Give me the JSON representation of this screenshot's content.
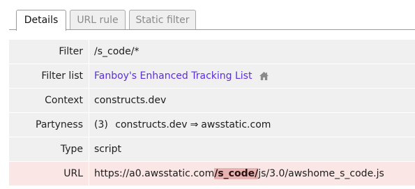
{
  "tabs": [
    {
      "label": "Details",
      "active": true
    },
    {
      "label": "URL rule",
      "active": false
    },
    {
      "label": "Static filter",
      "active": false
    }
  ],
  "details": {
    "filter": {
      "label": "Filter",
      "value": "/s_code/*"
    },
    "filter_list": {
      "label": "Filter list",
      "value": "Fanboy's Enhanced Tracking List",
      "icon": "home-icon"
    },
    "context": {
      "label": "Context",
      "value": "constructs.dev"
    },
    "partyness": {
      "label": "Partyness",
      "count": "(3)",
      "from": "constructs.dev",
      "arrow": "⇒",
      "to": "awsstatic.com"
    },
    "type": {
      "label": "Type",
      "value": "script"
    },
    "url": {
      "label": "URL",
      "prefix": "https://a0.awsstatic.com",
      "match": "/s_code/",
      "suffix": "js/3.0/awshome_s_code.js"
    }
  },
  "colors": {
    "link": "#5b2fd6",
    "url_row_bg": "#fbe6e6",
    "highlight": "#e7b2b2",
    "row_bg": "#f0f0f0"
  }
}
